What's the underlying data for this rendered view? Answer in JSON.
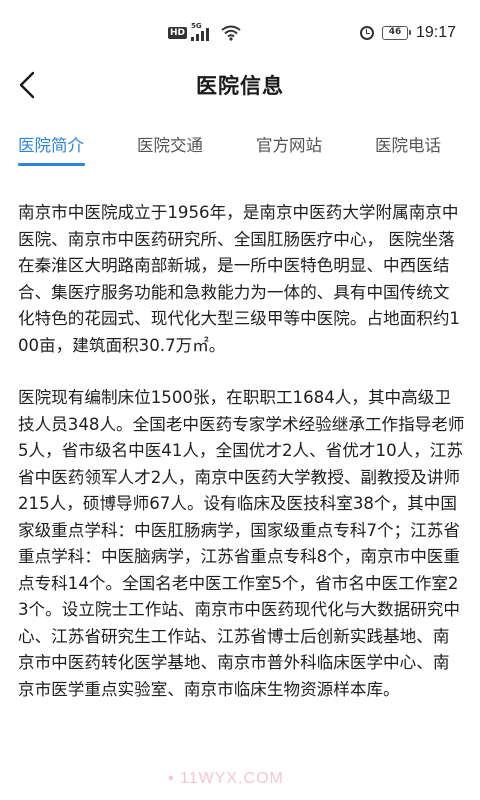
{
  "status_bar": {
    "hd": "HD",
    "network": "5G",
    "battery": "46",
    "time": "19:17"
  },
  "header": {
    "title": "医院信息"
  },
  "tabs": [
    {
      "label": "医院简介",
      "active": true
    },
    {
      "label": "医院交通",
      "active": false
    },
    {
      "label": "官方网站",
      "active": false
    },
    {
      "label": "医院电话",
      "active": false
    }
  ],
  "content": {
    "paragraphs": [
      "南京市中医院成立于1956年，是南京中医药大学附属南京中医院、南京市中医药研究所、全国肛肠医疗中心， 医院坐落在秦淮区大明路南部新城，是一所中医特色明显、中西医结合、集医疗服务功能和急救能力为一体的、具有中国传统文化特色的花园式、现代化大型三级甲等中医院。占地面积约100亩，建筑面积30.7万㎡。",
      "医院现有编制床位1500张，在职职工1684人，其中高级卫技人员348人。全国老中医药专家学术经验继承工作指导老师5人，省市级名中医41人，全国优才2人、省优才10人，江苏省中医药领军人才2人，南京中医药大学教授、副教授及讲师215人，硕博导师67人。设有临床及医技科室38个，其中国家级重点学科：中医肛肠病学，国家级重点专科7个；江苏省重点学科：中医脑病学，江苏省重点专科8个，南京市中医重点专科14个。全国名老中医工作室5个，省市名中医工作室23个。设立院士工作站、南京市中医药现代化与大数据研究中心、江苏省研究生工作站、江苏省博士后创新实践基地、南京市中医药转化医学基地、南京市普外科临床医学中心、南京市医学重点实验室、南京市临床生物资源样本库。"
    ]
  },
  "watermark": "•  11WYX.COM",
  "colors": {
    "accent": "#2e86d9",
    "text": "#1f1f1f",
    "tab_inactive": "#555555"
  }
}
